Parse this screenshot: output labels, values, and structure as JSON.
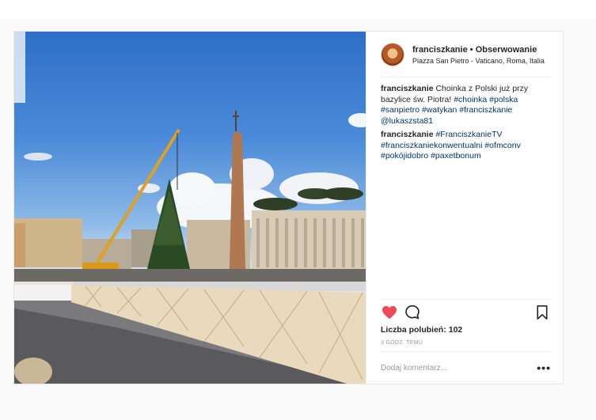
{
  "post": {
    "username": "franciszkanie",
    "separator": "•",
    "follow_label": "Obserwowanie",
    "location": "Piazza San Pietro - Vaticano, Roma, Italia",
    "comments": [
      {
        "user": "franciszkanie",
        "parts": [
          {
            "text": " Choinka z Polski już przy bazylice św. Piotra! ",
            "tag": false
          },
          {
            "text": "#choinka",
            "tag": true
          },
          {
            "text": " ",
            "tag": false
          },
          {
            "text": "#polska",
            "tag": true
          },
          {
            "text": " ",
            "tag": false
          },
          {
            "text": "#sanpietro",
            "tag": true
          },
          {
            "text": " ",
            "tag": false
          },
          {
            "text": "#watykan",
            "tag": true
          },
          {
            "text": " ",
            "tag": false
          },
          {
            "text": "#franciszkanie",
            "tag": true
          },
          {
            "text": " ",
            "tag": false
          },
          {
            "text": "@lukaszsta81",
            "tag": true
          }
        ]
      },
      {
        "user": "franciszkanie",
        "parts": [
          {
            "text": " ",
            "tag": false
          },
          {
            "text": "#FranciszkanieTV",
            "tag": true
          },
          {
            "text": " ",
            "tag": false
          },
          {
            "text": "#franciszkaniekonwentualni",
            "tag": true
          },
          {
            "text": " ",
            "tag": false
          },
          {
            "text": "#ofmconv",
            "tag": true
          },
          {
            "text": " ",
            "tag": false
          },
          {
            "text": "#pokójidobro",
            "tag": true
          },
          {
            "text": " ",
            "tag": false
          },
          {
            "text": "#paxetbonum",
            "tag": true
          }
        ]
      }
    ],
    "likes_text": "Liczba polubień: 102",
    "time_ago": "3 GODZ. TEMU",
    "comment_placeholder": "Dodaj komentarz...",
    "more_label": "•••",
    "liked": true,
    "colors": {
      "like": "#ed4956",
      "hashtag": "#003569",
      "muted": "#999999",
      "border": "#efefef"
    },
    "icons": {
      "like": "heart-icon",
      "comment": "comment-bubble-icon",
      "save": "bookmark-icon",
      "more": "more-options-icon"
    }
  }
}
